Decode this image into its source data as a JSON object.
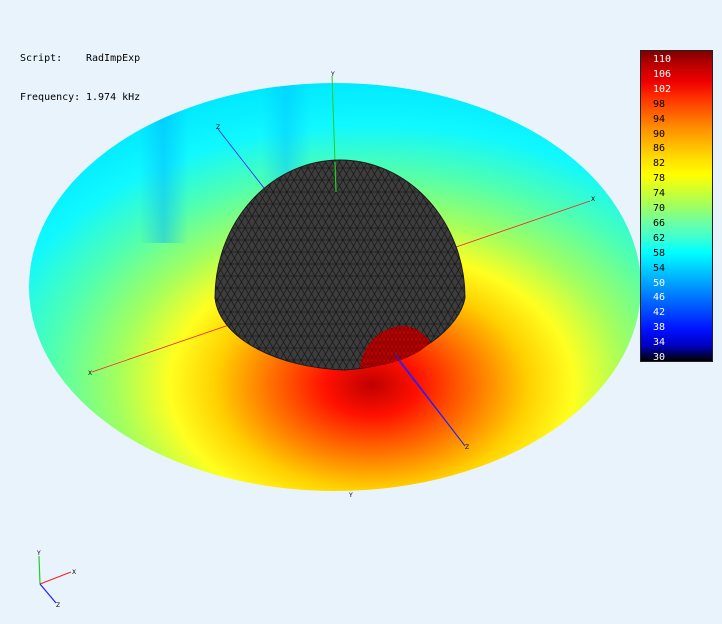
{
  "info": {
    "script_label": "Script:",
    "script_value": "RadImpExp",
    "frequency_label": "Frequency:",
    "frequency_value": "1.974 kHz"
  },
  "colorbar": {
    "labels": [
      "110",
      "106",
      "102",
      "98",
      "94",
      "90",
      "86",
      "82",
      "78",
      "74",
      "70",
      "66",
      "62",
      "58",
      "54",
      "50",
      "46",
      "42",
      "38",
      "34",
      "30"
    ],
    "colors": [
      "#800000",
      "#c00000",
      "#f00000",
      "#ff3000",
      "#ff6000",
      "#ff9000",
      "#ffb800",
      "#ffe000",
      "#ffff00",
      "#d0ff30",
      "#a0ff60",
      "#70ffa0",
      "#40ffd0",
      "#00ffff",
      "#00d0ff",
      "#00a0ff",
      "#0070ff",
      "#0040ff",
      "#0010ff",
      "#0000c0",
      "#000000"
    ]
  },
  "axes": {
    "x_label": "X",
    "y_label": "Y",
    "z_label": "Z",
    "x_color": "#ff2020",
    "y_color": "#20d020",
    "z_color": "#2020ff"
  },
  "scene": {
    "dome_color": "#3d3d3d",
    "mesh_color": "#1c1c1c",
    "source_color": "#c00000"
  }
}
